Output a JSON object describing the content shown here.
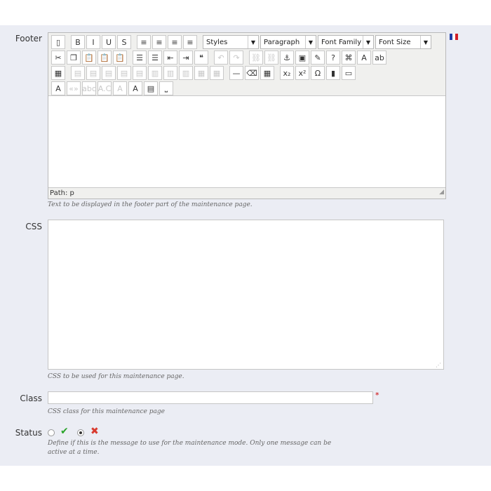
{
  "footer": {
    "label": "Footer",
    "help": "Text to be displayed in the footer part of the maintenance page.",
    "status_path": "Path: p",
    "selects": [
      {
        "name": "styles-select",
        "value": "Styles"
      },
      {
        "name": "paragraph-select",
        "value": "Paragraph"
      },
      {
        "name": "font-family-select",
        "value": "Font Family"
      },
      {
        "name": "font-size-select",
        "value": "Font Size"
      }
    ],
    "flag_colors": [
      "#1f3fa6",
      "#ffffff",
      "#d21f27"
    ]
  },
  "css": {
    "label": "CSS",
    "help": "CSS to be used for this maintenance page."
  },
  "class_field": {
    "label": "Class",
    "help": "CSS class for this maintenance page",
    "required_mark": "*"
  },
  "status": {
    "label": "Status",
    "help_line1": "Define if this is the message to use for the maintenance mode. Only one message can be",
    "help_line2": "active at a time."
  },
  "icons": {
    "enabled": "check-icon",
    "disabled": "cross-icon",
    "accent_green": "#2aa42a",
    "accent_red": "#d83a2e"
  },
  "toolbar": {
    "row1": [
      {
        "name": "new-document-icon",
        "glyph": "▯"
      },
      {
        "name": "bold-button",
        "glyph": "B"
      },
      {
        "name": "italic-button",
        "glyph": "I"
      },
      {
        "name": "underline-button",
        "glyph": "U"
      },
      {
        "name": "strikethrough-button",
        "glyph": "S"
      },
      {
        "name": "align-left-button",
        "glyph": "≡"
      },
      {
        "name": "align-center-button",
        "glyph": "≡"
      },
      {
        "name": "align-right-button",
        "glyph": "≡"
      },
      {
        "name": "align-justify-button",
        "glyph": "≡"
      }
    ],
    "row2": [
      {
        "name": "cut-icon",
        "glyph": "✂"
      },
      {
        "name": "copy-icon",
        "glyph": "❐"
      },
      {
        "name": "paste-icon",
        "glyph": "📋"
      },
      {
        "name": "paste-text-icon",
        "glyph": "📋"
      },
      {
        "name": "paste-word-icon",
        "glyph": "📋"
      },
      {
        "name": "bullet-list-icon",
        "glyph": "☰"
      },
      {
        "name": "numbered-list-icon",
        "glyph": "☰"
      },
      {
        "name": "outdent-icon",
        "glyph": "⇤"
      },
      {
        "name": "indent-icon",
        "glyph": "⇥"
      },
      {
        "name": "blockquote-icon",
        "glyph": "❝"
      },
      {
        "name": "undo-icon",
        "glyph": "↶"
      },
      {
        "name": "redo-icon",
        "glyph": "↷"
      },
      {
        "name": "link-icon",
        "glyph": "⛓"
      },
      {
        "name": "unlink-icon",
        "glyph": "⛓"
      },
      {
        "name": "anchor-icon",
        "glyph": "⚓"
      },
      {
        "name": "image-icon",
        "glyph": "▣"
      },
      {
        "name": "cleanup-icon",
        "glyph": "✎"
      },
      {
        "name": "help-icon",
        "glyph": "?"
      },
      {
        "name": "html-icon",
        "glyph": "⌘"
      },
      {
        "name": "font-color-icon",
        "glyph": "A"
      },
      {
        "name": "highlight-icon",
        "glyph": "ab"
      }
    ],
    "row3": [
      {
        "name": "table-icon",
        "glyph": "▦"
      },
      {
        "name": "row-props-icon",
        "glyph": "▤"
      },
      {
        "name": "cell-props-icon",
        "glyph": "▤"
      },
      {
        "name": "insert-row-before-icon",
        "glyph": "▤"
      },
      {
        "name": "insert-row-after-icon",
        "glyph": "▤"
      },
      {
        "name": "delete-row-icon",
        "glyph": "▤"
      },
      {
        "name": "insert-col-before-icon",
        "glyph": "▥"
      },
      {
        "name": "insert-col-after-icon",
        "glyph": "▥"
      },
      {
        "name": "delete-col-icon",
        "glyph": "▥"
      },
      {
        "name": "split-cells-icon",
        "glyph": "▦"
      },
      {
        "name": "merge-cells-icon",
        "glyph": "▦"
      },
      {
        "name": "horizontal-rule-icon",
        "glyph": "—"
      },
      {
        "name": "remove-format-icon",
        "glyph": "⌫"
      },
      {
        "name": "visual-aid-icon",
        "glyph": "▦"
      },
      {
        "name": "subscript-icon",
        "glyph": "x₂"
      },
      {
        "name": "superscript-icon",
        "glyph": "x²"
      },
      {
        "name": "special-char-icon",
        "glyph": "Ω"
      },
      {
        "name": "media-icon",
        "glyph": "▮"
      },
      {
        "name": "fullscreen-icon",
        "glyph": "▭"
      }
    ],
    "row4": [
      {
        "name": "spellcheck-icon",
        "glyph": "A"
      },
      {
        "name": "cite-icon",
        "glyph": "«»"
      },
      {
        "name": "abbr-icon",
        "glyph": "abc"
      },
      {
        "name": "acronym-icon",
        "glyph": "A.C"
      },
      {
        "name": "delete-text-icon",
        "glyph": "A"
      },
      {
        "name": "insert-text-icon",
        "glyph": "A"
      },
      {
        "name": "attributes-icon",
        "glyph": "▤"
      },
      {
        "name": "nonbreaking-icon",
        "glyph": "⎵"
      }
    ]
  }
}
